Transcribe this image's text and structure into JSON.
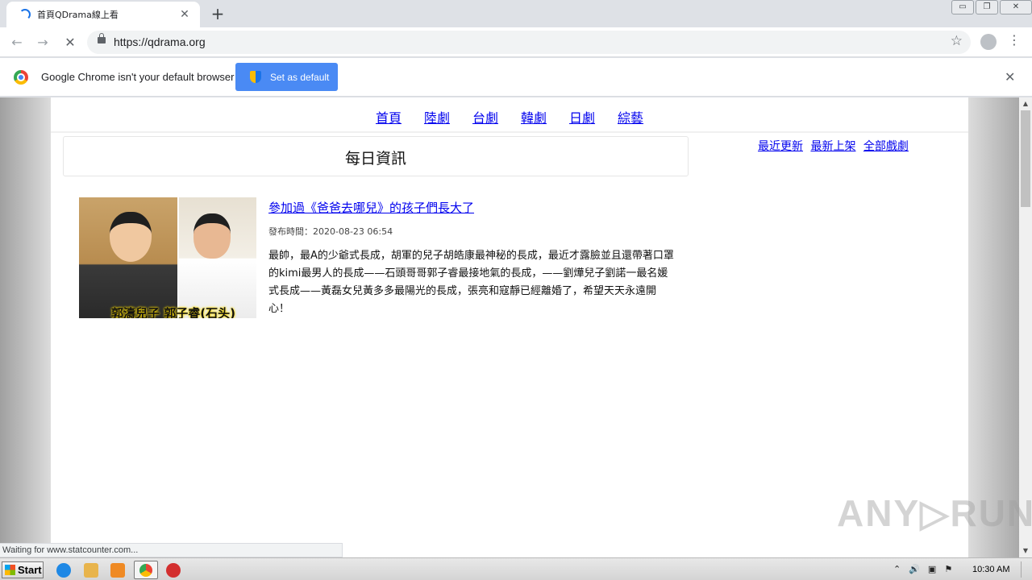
{
  "browser": {
    "tab_title": "首頁QDrama線上看",
    "tab_close": "✕",
    "new_tab": "+",
    "back": "←",
    "forward": "→",
    "reload": "✕",
    "url": "https://qdrama.org",
    "star": "☆",
    "menu": "⋮",
    "window_controls": [
      "▭",
      "❐",
      "✕"
    ],
    "status": "Waiting for www.statcounter.com..."
  },
  "infobar": {
    "message": "Google Chrome isn't your default browser",
    "button_label": "Set as default",
    "close": "✕"
  },
  "site": {
    "nav": [
      "首頁",
      "陸劇",
      "台劇",
      "韓劇",
      "日劇",
      "綜藝"
    ],
    "section_title": "每日資訊",
    "side_links": [
      "最近更新",
      "最新上架",
      "全部戲劇"
    ]
  },
  "article": {
    "title": "參加過《爸爸去哪兒》的孩子們長大了",
    "date": "發布時間：2020-08-23 06:54",
    "body": "最帥，最A的少爺式長成，胡軍的兒子胡皓康最神秘的長成，最近才露臉並且還帶著口罩的kimi最男人的長成——石頭哥哥郭子睿最接地氣的長成，——劉燁兒子劉諾一最名媛式長成——黃磊女兒黃多多最陽光的長成，張亮和寇靜已經離婚了，希望天天永遠開心！",
    "thumb_caption": "郭濤兒子 郭子睿(石头)"
  },
  "watermark": "ANY▷RUN",
  "taskbar": {
    "start": "Start",
    "clock": "10:30 AM",
    "tray_icons": [
      "⌃",
      "🔊",
      "▣",
      "⚑"
    ]
  },
  "icons": {
    "tab_spinner": "loading-spinner-icon",
    "lock": "lock-icon",
    "shield": "uac-shield-icon",
    "chrome": "chrome-logo-icon"
  }
}
